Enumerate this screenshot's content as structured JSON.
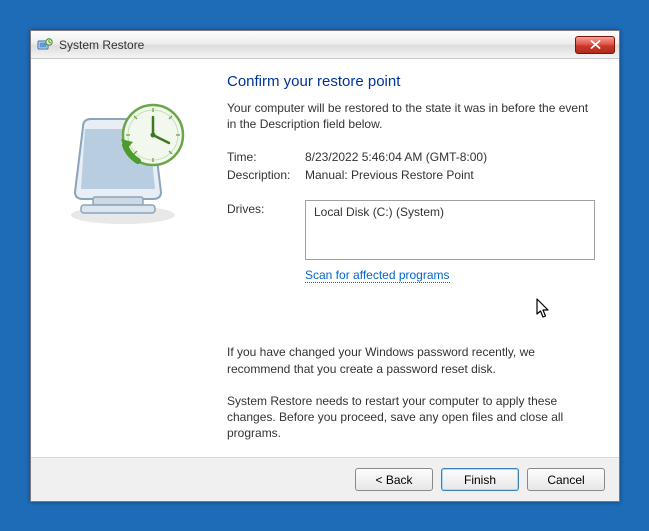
{
  "window": {
    "title": "System Restore"
  },
  "main": {
    "heading": "Confirm your restore point",
    "desc": "Your computer will be restored to the state it was in before the event in the Description field below.",
    "time_label": "Time:",
    "time_value": "8/23/2022 5:46:04 AM (GMT-8:00)",
    "description_label": "Description:",
    "description_value": "Manual: Previous Restore Point",
    "drives_label": "Drives:",
    "drives_value": "Local Disk (C:) (System)",
    "scan_link": "Scan for affected programs",
    "note1": "If you have changed your Windows password recently, we recommend that you create a password reset disk.",
    "note2": "System Restore needs to restart your computer to apply these changes. Before you proceed, save any open files and close all programs."
  },
  "buttons": {
    "back": "< Back",
    "finish": "Finish",
    "cancel": "Cancel"
  }
}
